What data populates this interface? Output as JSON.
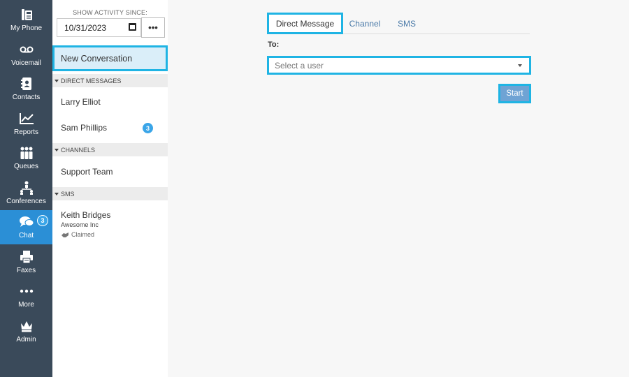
{
  "nav": {
    "items": [
      {
        "label": "My Phone",
        "icon": "phone-icon"
      },
      {
        "label": "Voicemail",
        "icon": "voicemail-icon"
      },
      {
        "label": "Contacts",
        "icon": "contacts-icon"
      },
      {
        "label": "Reports",
        "icon": "reports-icon"
      },
      {
        "label": "Queues",
        "icon": "queues-icon"
      },
      {
        "label": "Conferences",
        "icon": "conferences-icon"
      },
      {
        "label": "Chat",
        "icon": "chat-icon",
        "badge": "3",
        "active": true
      },
      {
        "label": "Faxes",
        "icon": "fax-icon"
      },
      {
        "label": "More",
        "icon": "more-icon"
      },
      {
        "label": "Admin",
        "icon": "admin-crown-icon"
      }
    ]
  },
  "sidebar": {
    "since_label": "SHOW ACTIVITY SINCE:",
    "since_date": "10/31/2023",
    "more_label": "•••",
    "new_conversation": "New Conversation",
    "sections": {
      "direct": {
        "title": "DIRECT MESSAGES",
        "items": [
          {
            "name": "Larry Elliot"
          },
          {
            "name": "Sam Phillips",
            "badge": "3"
          }
        ]
      },
      "channels": {
        "title": "CHANNELS",
        "items": [
          {
            "name": "Support Team"
          }
        ]
      },
      "sms": {
        "title": "SMS",
        "items": [
          {
            "name": "Keith Bridges",
            "company": "Awesome Inc",
            "status": "Claimed"
          }
        ]
      }
    }
  },
  "main": {
    "tabs": [
      {
        "label": "Direct Message",
        "active": true
      },
      {
        "label": "Channel"
      },
      {
        "label": "SMS"
      }
    ],
    "to_label": "To:",
    "select_placeholder": "Select a user",
    "start_label": "Start"
  },
  "colors": {
    "rail_bg": "#3a4a5a",
    "rail_active": "#2b8fd6",
    "highlight": "#1fb4e4",
    "badge": "#3aa5e8",
    "start_button": "#6fa3d4"
  }
}
